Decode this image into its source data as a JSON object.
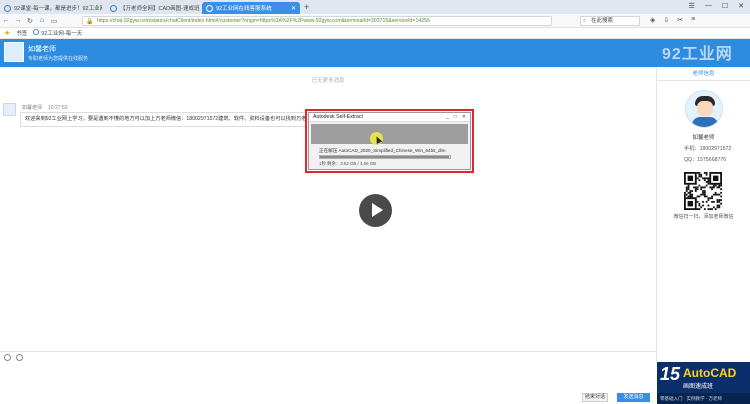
{
  "browser": {
    "tabs": [
      {
        "label": "92课堂-每一课，都是进步！92工业网",
        "active": false
      },
      {
        "label": "【万老师全网】CAD画图-速成班-92",
        "active": false
      },
      {
        "label": "92工业网在线客服系统",
        "active": true
      }
    ],
    "url": "https://chat.92gyw.com/statics/chatClient/index.html#/customer?origin=https%3A%2F%2Fwww.92gyw.com&terminalId=303715&serviceId=14256",
    "search_placeholder": "在此搜索",
    "bookmarks": [
      "书签",
      "92工业网-每一天"
    ]
  },
  "chat_header": {
    "name": "如馨老师",
    "subtitle": "专职老师为您提供在线服务",
    "brand": "92工业网"
  },
  "chat": {
    "history_label": "已无更多消息",
    "message": {
      "sender": "如馨老师",
      "time": "10:27:50",
      "text": "欢迎来到92工业网上学习，要是遇到不懂的地方可以加上万老师微信：18002971572建筑、软件、资料设备也可以找到万老师领取10"
    }
  },
  "dialog": {
    "title": "Autodesk Self-Extract",
    "progress_text": "正在解压 AutoCAD_2020_Simplified_Chinese_Win_64bit_dlm",
    "progress": 0.99,
    "status": "1秒 剩余：3.52 GB / 3.56 GB"
  },
  "input": {
    "close_label": "结束对话",
    "send_label": "发送消息"
  },
  "profile": {
    "panel_title": "老师信息",
    "name": "如馨老师",
    "phone_label": "手机：",
    "phone": "18002971572",
    "qq_label": "QQ：",
    "qq": "1575668776",
    "qr_caption": "微信扫一扫，添加老师微信"
  },
  "ad": {
    "number": "15",
    "product": "AutoCAD",
    "subtitle": "画图速成班",
    "strip": "零基础入门 · 实例教学 · 万老师"
  },
  "colors": {
    "accent": "#2d8ce0",
    "dialog_frame": "#e0262e"
  }
}
